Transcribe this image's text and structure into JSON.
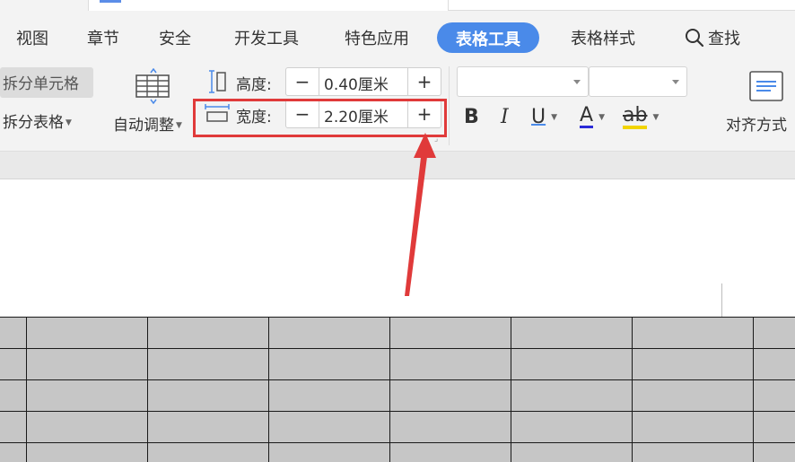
{
  "menu": {
    "tabs": [
      {
        "label": "视图"
      },
      {
        "label": "章节"
      },
      {
        "label": "安全"
      },
      {
        "label": "开发工具"
      },
      {
        "label": "特色应用"
      },
      {
        "label": "表格工具"
      },
      {
        "label": "表格样式"
      }
    ],
    "search_label": "查找",
    "active_tab": "表格工具",
    "accent_color": "#4a8ae9"
  },
  "ribbon": {
    "split_cell_label": "拆分单元格",
    "split_table_label": "拆分表格",
    "autofit_label": "自动调整",
    "height": {
      "label": "高度:",
      "value": "0.40厘米",
      "minus": "−",
      "plus": "+"
    },
    "width": {
      "label": "宽度:",
      "value": "2.20厘米",
      "minus": "−",
      "plus": "+"
    },
    "font_name": "",
    "font_size": "",
    "format": {
      "bold": "B",
      "italic": "I",
      "underline": "U",
      "font_color": "A",
      "highlight": "ab"
    },
    "align_label": "对齐方式",
    "highlight_color": "#e03a3a"
  },
  "table": {
    "rows": 5,
    "cols": 8,
    "fill_color": "#c6c6c6"
  }
}
